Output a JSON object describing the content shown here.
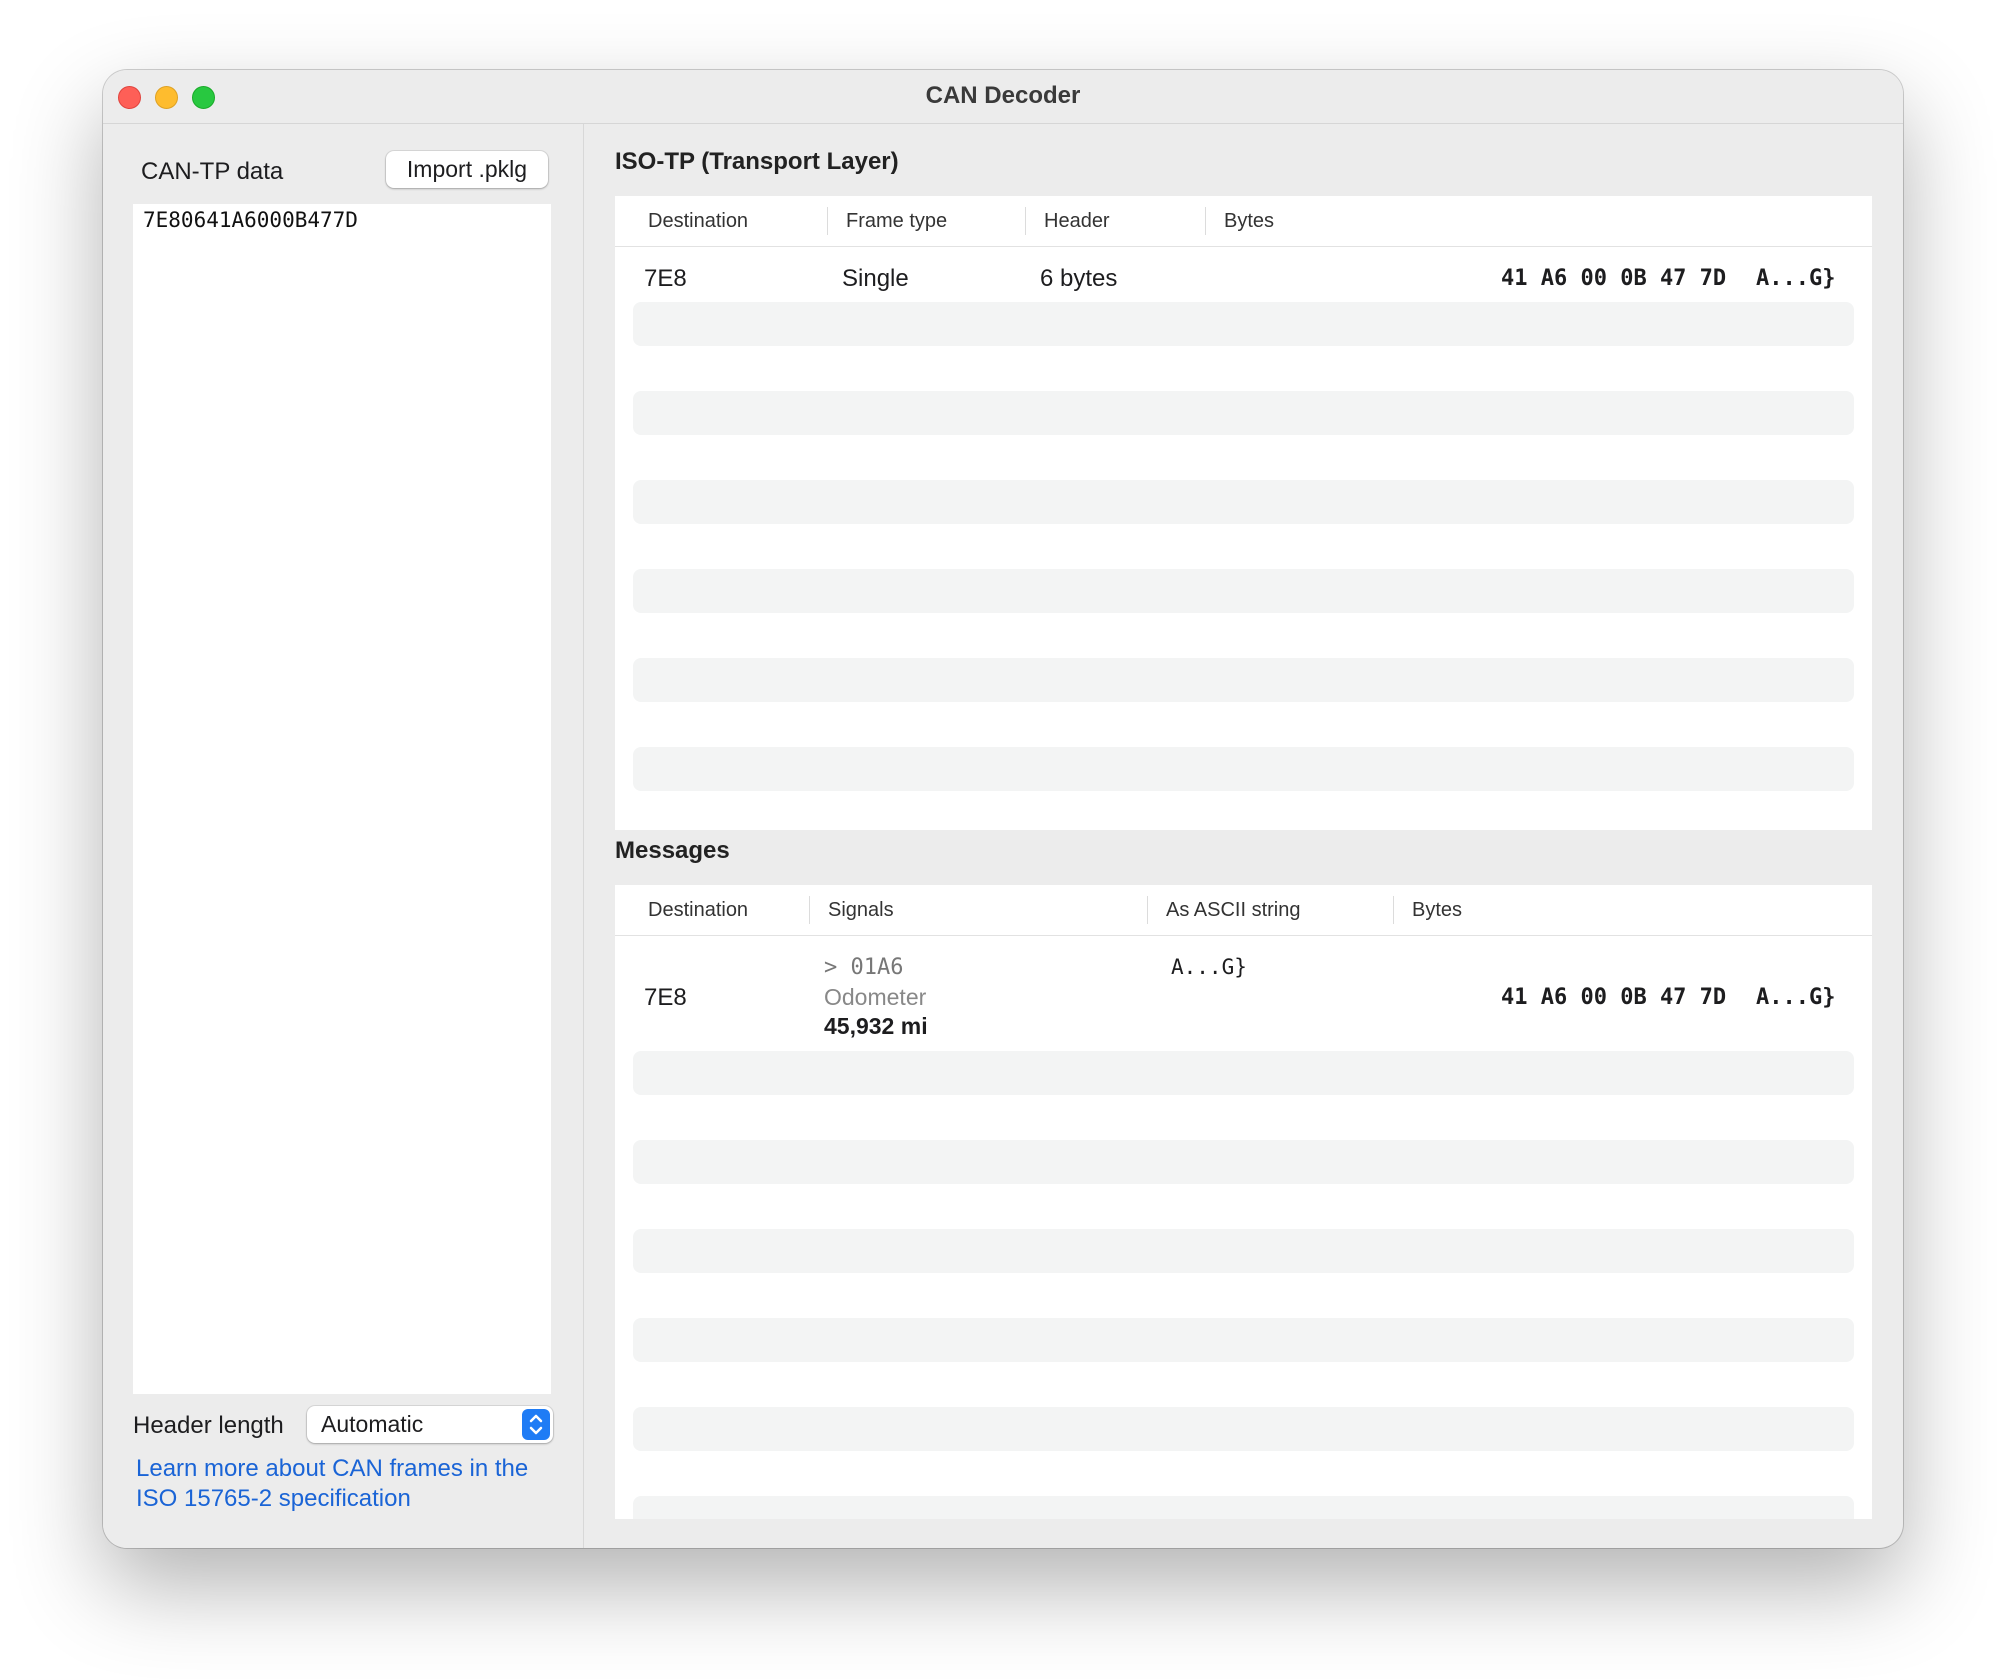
{
  "window": {
    "title": "CAN Decoder"
  },
  "left": {
    "label": "CAN-TP data",
    "import_button": "Import .pklg",
    "input_value": "7E80641A6000B477D",
    "header_length_label": "Header length",
    "header_length_value": "Automatic",
    "learn_more_line1": "Learn more about CAN frames in the",
    "learn_more_line2": "ISO 15765-2 specification"
  },
  "isotp": {
    "title": "ISO-TP (Transport Layer)",
    "columns": [
      "Destination",
      "Frame type",
      "Header",
      "Bytes"
    ],
    "rows": [
      {
        "destination": "7E8",
        "frame_type": "Single",
        "header": "6 bytes",
        "bytes": "41 A6 00 0B 47 7D",
        "ascii": "A...G}"
      }
    ]
  },
  "messages": {
    "title": "Messages",
    "columns": [
      "Destination",
      "Signals",
      "As ASCII string",
      "Bytes"
    ],
    "rows": [
      {
        "destination": "7E8",
        "signal_id": "> 01A6",
        "signal_name": "Odometer",
        "signal_value": "45,932 mi",
        "ascii_string": "A...G}",
        "bytes": "41 A6 00 0B 47 7D",
        "ascii": "A...G}"
      }
    ]
  },
  "colors": {
    "accent": "#1f7cf5",
    "link": "#1a64d6"
  },
  "icons": {
    "stepper": "chevron-up-down-icon"
  }
}
